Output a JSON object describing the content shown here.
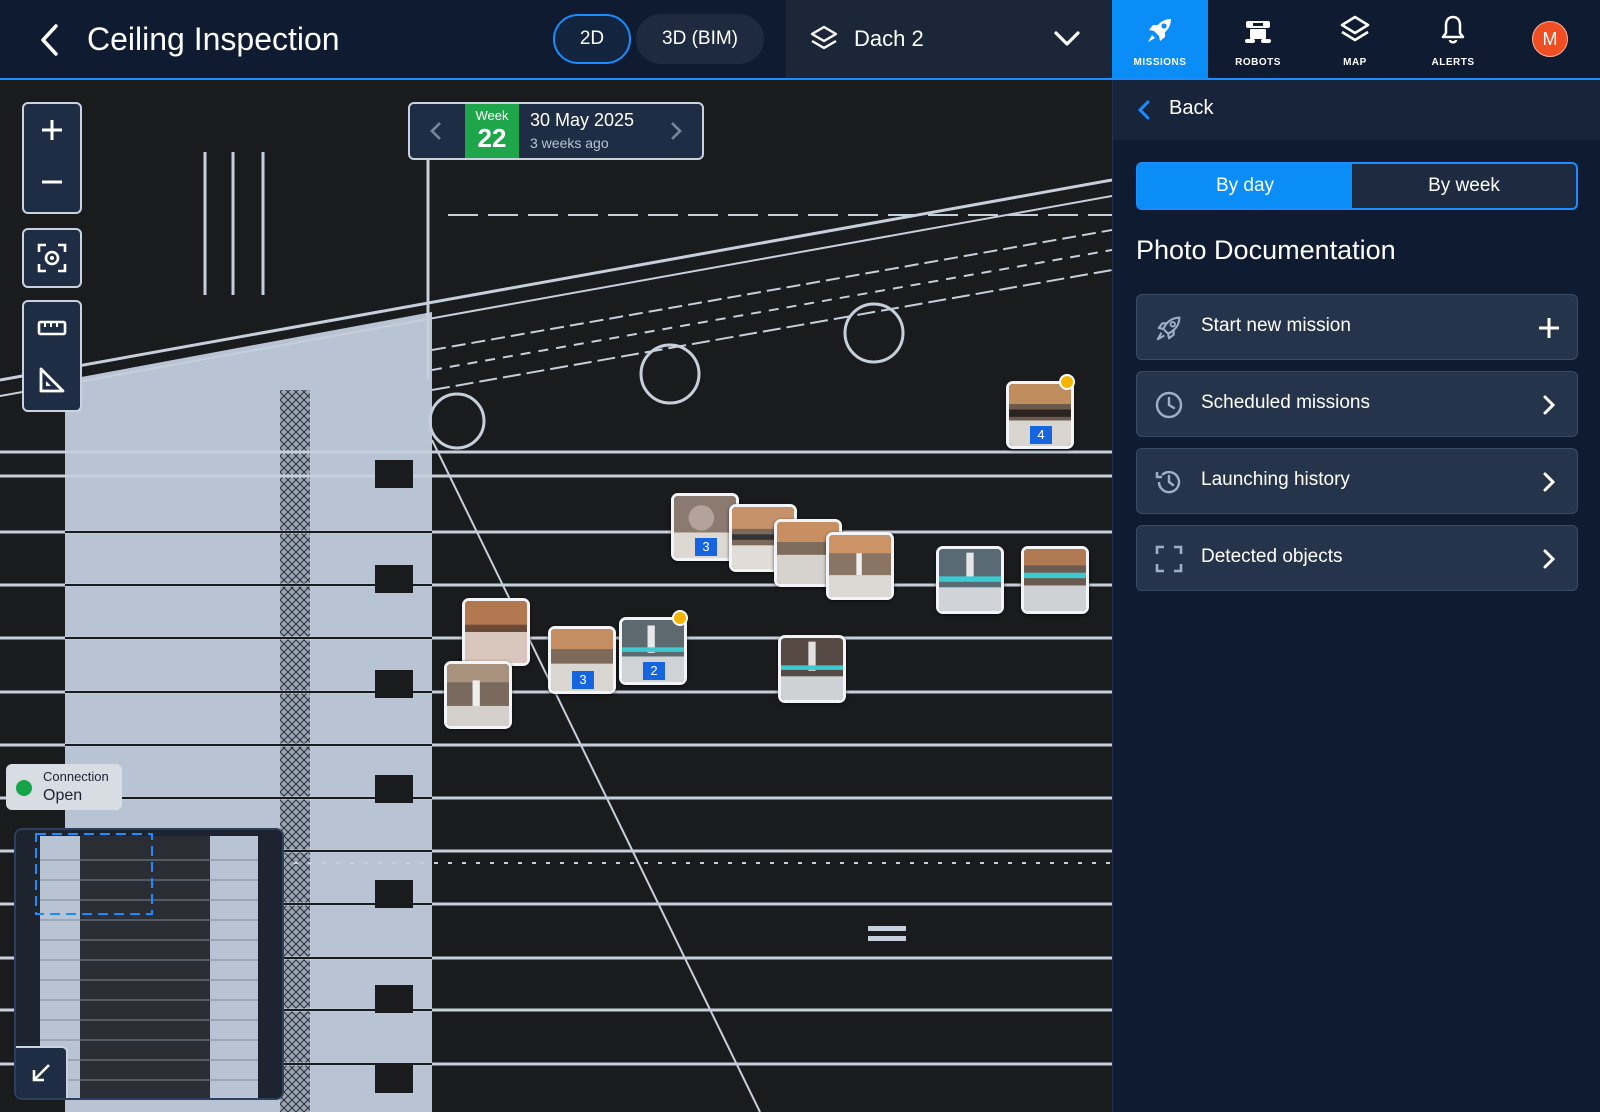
{
  "header": {
    "title": "Ceiling Inspection",
    "view_2d": "2D",
    "view_3d": "3D (BIM)",
    "level": "Dach 2",
    "nav": [
      {
        "label": "MISSIONS",
        "icon": "rocket-icon",
        "active": true
      },
      {
        "label": "ROBOTS",
        "icon": "robot-icon",
        "active": false
      },
      {
        "label": "MAP",
        "icon": "layers-icon",
        "active": false
      },
      {
        "label": "ALERTS",
        "icon": "bell-icon",
        "active": false
      }
    ],
    "avatar_initial": "M"
  },
  "week_nav": {
    "week_label": "Week",
    "week_number": "22",
    "date": "30 May 2025",
    "relative": "3 weeks ago"
  },
  "photos": [
    {
      "count": "4",
      "status_dot": true
    },
    {
      "count": "3",
      "status_dot": false
    },
    {
      "count": "",
      "status_dot": false
    },
    {
      "count": "",
      "status_dot": false
    },
    {
      "count": "",
      "status_dot": false
    },
    {
      "count": "",
      "status_dot": false
    },
    {
      "count": "",
      "status_dot": false
    },
    {
      "count": "",
      "status_dot": false
    },
    {
      "count": "3",
      "status_dot": false
    },
    {
      "count": "2",
      "status_dot": true
    },
    {
      "count": "",
      "status_dot": false
    },
    {
      "count": "",
      "status_dot": false
    }
  ],
  "connection": {
    "label": "Connection",
    "value": "Open",
    "status_color": "#17a34a"
  },
  "panel": {
    "back_label": "Back",
    "tabs": {
      "day": "By day",
      "week": "By week",
      "active": "day"
    },
    "heading": "Photo Documentation",
    "menu": [
      {
        "label": "Start new mission",
        "icon": "rocket-icon",
        "end": "plus-icon"
      },
      {
        "label": "Scheduled missions",
        "icon": "clock-icon",
        "end": "chevron-right-icon"
      },
      {
        "label": "Launching history",
        "icon": "history-icon",
        "end": "chevron-right-icon"
      },
      {
        "label": "Detected objects",
        "icon": "scan-frame-icon",
        "end": "chevron-right-icon"
      }
    ]
  },
  "colors": {
    "accent": "#0b8df8",
    "header_bg": "#0f1b30",
    "week_badge": "#1fa64a",
    "photo_badge": "#1565e0",
    "status_dot": "#f6b400",
    "avatar": "#f04e23"
  }
}
